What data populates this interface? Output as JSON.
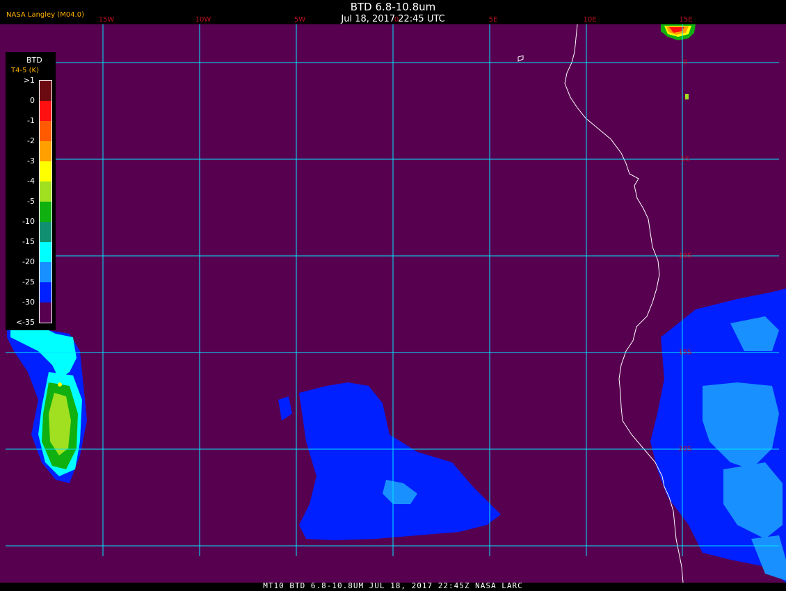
{
  "header": {
    "title": "BTD 6.8-10.8um",
    "subtitle": "Jul 18, 2017 22:45 UTC",
    "credit": "NASA Langley (M04.0)"
  },
  "footer": {
    "text": "MT10  BTD 6.8-10.8UM   JUL 18, 2017 22:45Z   NASA LARC"
  },
  "colorbar": {
    "title": "BTD",
    "units": "T4-5 (K)",
    "labels": [
      ">1",
      "0",
      "-1",
      "-2",
      "-3",
      "-4",
      "-5",
      "-10",
      "-15",
      "-20",
      "-25",
      "-30",
      "<-35"
    ],
    "colors": [
      "#6b0a10",
      "#ff1010",
      "#ff5a00",
      "#ffa000",
      "#ffff00",
      "#a0e020",
      "#10b010",
      "#109070",
      "#00ffff",
      "#1890ff",
      "#0020ff",
      "#580050"
    ]
  },
  "map": {
    "background_color": "#580050",
    "grid_color": "#00e8ff",
    "coastline_color": "#ffffff",
    "longitude_labels": [
      "15W",
      "10W",
      "5W",
      "0",
      "5E",
      "10E",
      "15E"
    ],
    "latitude_labels": [
      "0",
      "5S",
      "10S",
      "15S",
      "20S"
    ]
  }
}
